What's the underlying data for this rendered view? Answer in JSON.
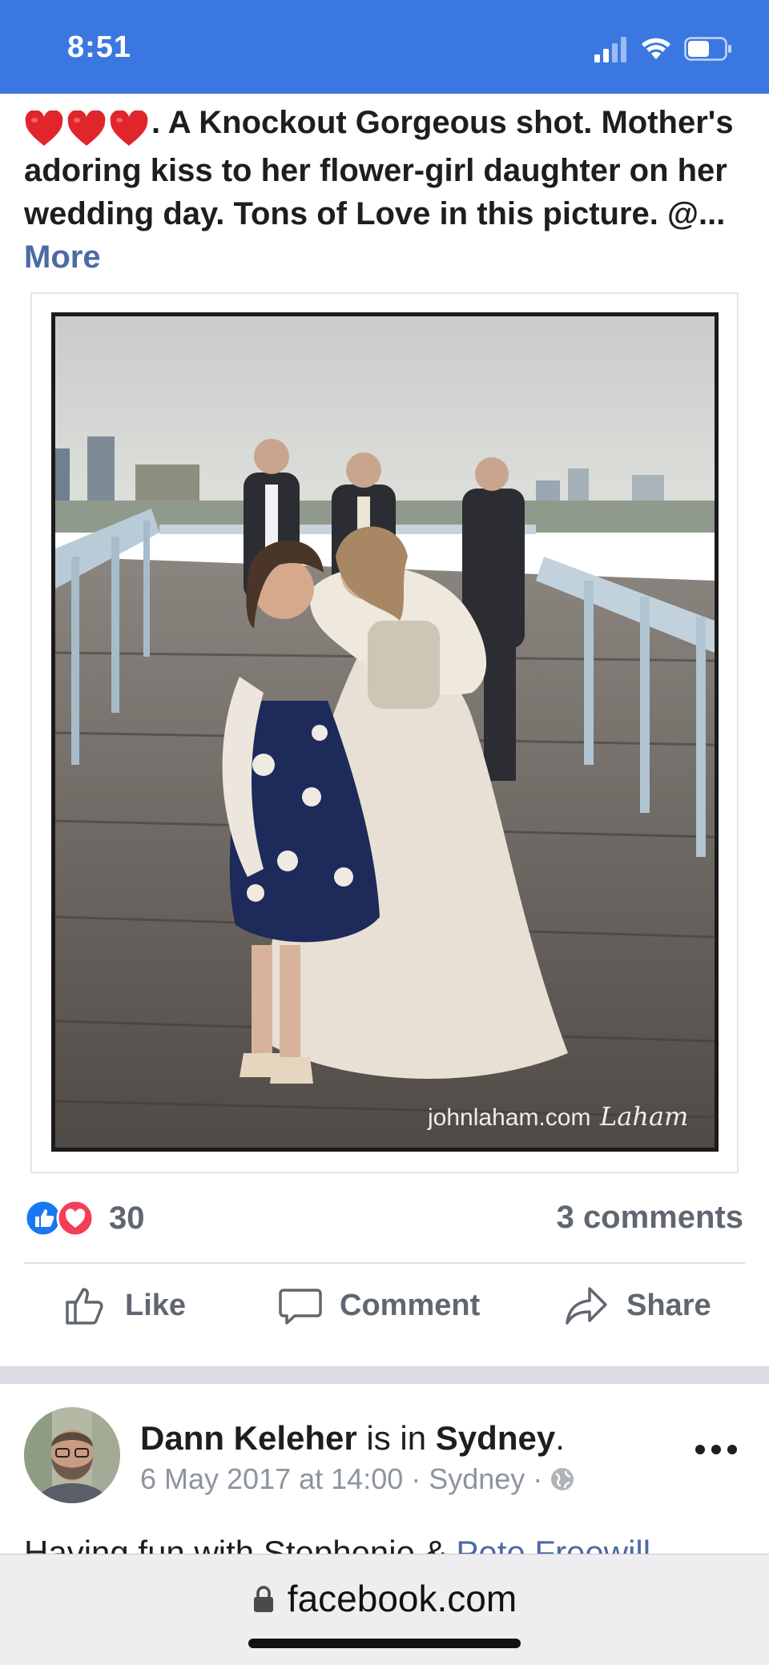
{
  "status_bar": {
    "time": "8:51"
  },
  "post": {
    "caption_prefix": ". A Knockout Gorgeous shot. Mother's adoring kiss to her flower-girl daughter on her wedding day. Tons of Love in this picture. @...",
    "more_label": "More",
    "photo_watermark": "johnlaham.com",
    "photo_signature": "Laham",
    "reaction_count": "30",
    "comments_label": "3 comments",
    "actions": {
      "like": "Like",
      "comment": "Comment",
      "share": "Share"
    }
  },
  "next_post": {
    "author": "Dann Keleher",
    "is_in": "is in",
    "place": "Sydney",
    "period": ".",
    "timestamp": "6 May 2017 at 14:00 · Sydney ·",
    "text_start": "Having fun with Stephenie &",
    "mention": "Pete Freewill"
  },
  "browser": {
    "url": "facebook.com"
  },
  "colors": {
    "status_bar": "#3b77e0",
    "link": "#4b6aa7",
    "like_blue": "#1877f2",
    "love_red": "#f33e58"
  }
}
